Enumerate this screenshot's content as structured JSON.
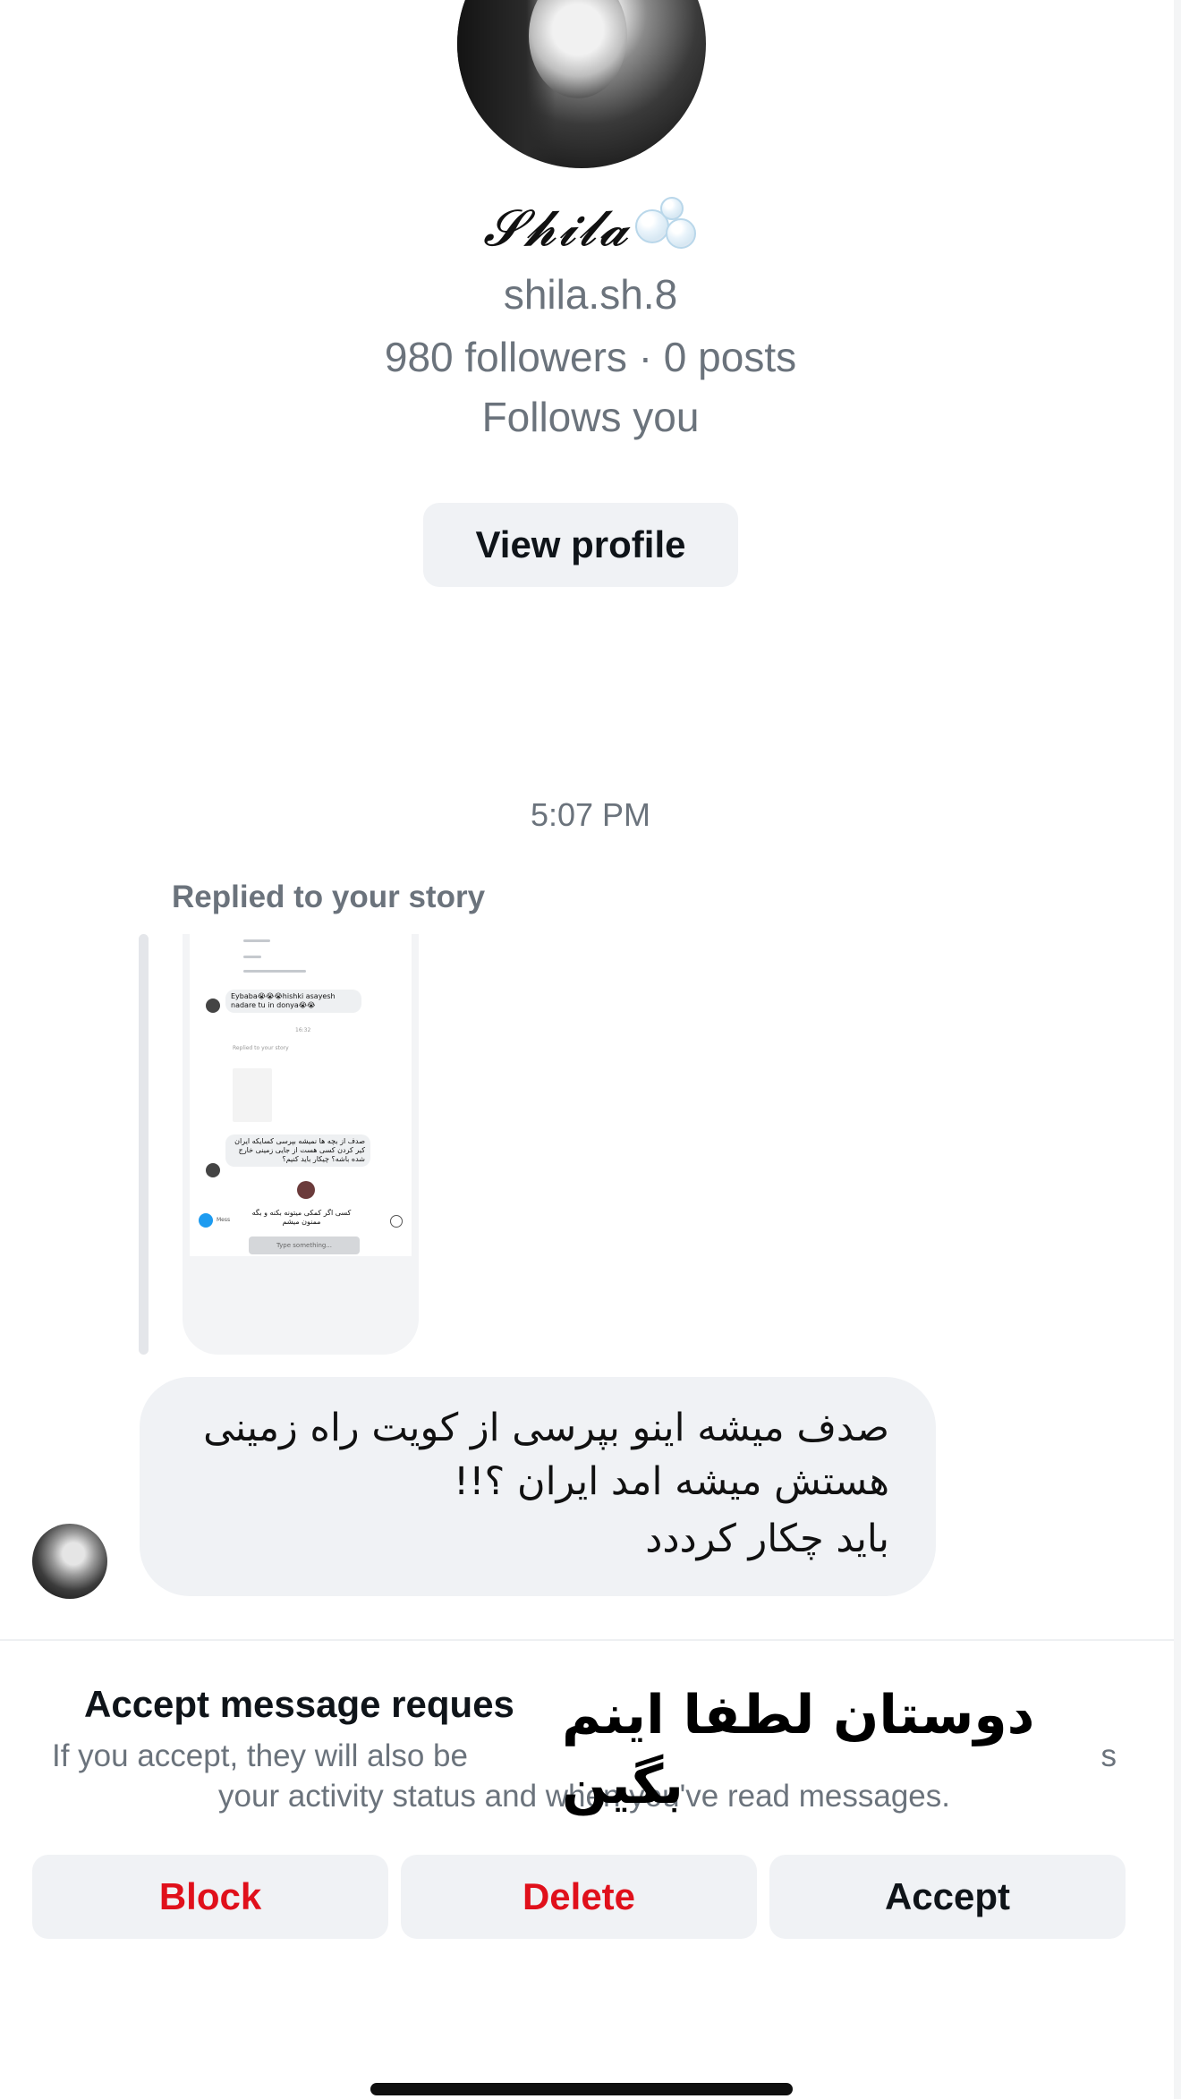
{
  "profile": {
    "display_name": "𝓢𝓱𝓲𝓵𝓪",
    "username": "shila.sh.8",
    "stats": "980 followers · 0 posts",
    "follows_status": "Follows you",
    "view_profile_label": "View profile"
  },
  "conversation": {
    "timestamp": "5:07 PM",
    "replied_label": "Replied to your story",
    "story_preview": {
      "bubble_1": "Eybaba😭😭😭hishki asayesh nadare tu in donya😭😭",
      "time_text": "16:32",
      "replied_text": "Replied to your story",
      "bubble_2": "صدف از بچه ها نمیشه بپرسی کسایکه ایران کیر کردن کسی هست از جایی زمینی خارج شده باشه؟ چیکار باید کنیم؟",
      "bubble_3": "کسی اگر کمکی میتونه بکنه و بگه ممنون میشم",
      "input_left": "Mess",
      "input_placeholder": "Type something..."
    },
    "message_lines": [
      "صدف میشه اینو بپرسی از کویت راه زمینی",
      "هستش میشه امد ایران ؟!!",
      "باید چکار کرددد"
    ]
  },
  "request": {
    "title": "Accept message reques",
    "description_left": "If you accept, they will also be",
    "description_right": "s",
    "description_line2": "your activity status and when you've read messages.",
    "overlay_caption": "دوستان لطفا اینم بگین",
    "buttons": {
      "block": "Block",
      "delete": "Delete",
      "accept": "Accept"
    }
  },
  "colors": {
    "muted_text": "#6b737c",
    "button_bg": "#f0f2f5",
    "danger": "#e0101b"
  }
}
